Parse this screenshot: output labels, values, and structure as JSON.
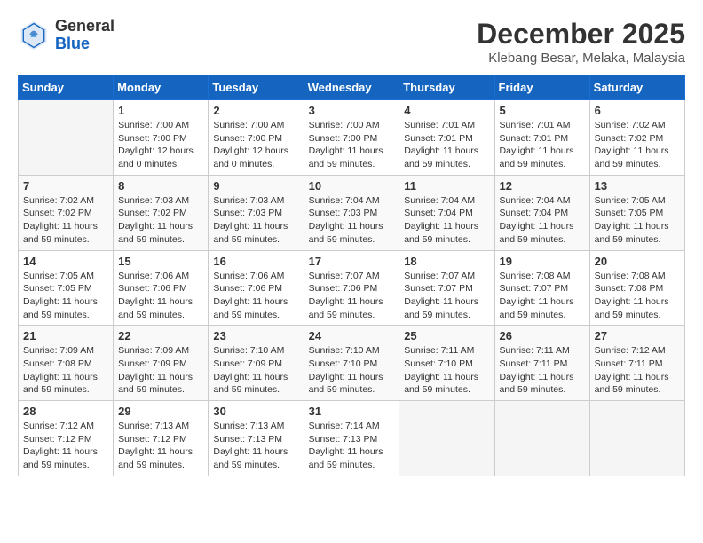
{
  "header": {
    "logo_general": "General",
    "logo_blue": "Blue",
    "month_title": "December 2025",
    "location": "Klebang Besar, Melaka, Malaysia"
  },
  "days_of_week": [
    "Sunday",
    "Monday",
    "Tuesday",
    "Wednesday",
    "Thursday",
    "Friday",
    "Saturday"
  ],
  "weeks": [
    [
      {
        "day": "",
        "info": ""
      },
      {
        "day": "1",
        "info": "Sunrise: 7:00 AM\nSunset: 7:00 PM\nDaylight: 12 hours\nand 0 minutes."
      },
      {
        "day": "2",
        "info": "Sunrise: 7:00 AM\nSunset: 7:00 PM\nDaylight: 12 hours\nand 0 minutes."
      },
      {
        "day": "3",
        "info": "Sunrise: 7:00 AM\nSunset: 7:00 PM\nDaylight: 11 hours\nand 59 minutes."
      },
      {
        "day": "4",
        "info": "Sunrise: 7:01 AM\nSunset: 7:01 PM\nDaylight: 11 hours\nand 59 minutes."
      },
      {
        "day": "5",
        "info": "Sunrise: 7:01 AM\nSunset: 7:01 PM\nDaylight: 11 hours\nand 59 minutes."
      },
      {
        "day": "6",
        "info": "Sunrise: 7:02 AM\nSunset: 7:02 PM\nDaylight: 11 hours\nand 59 minutes."
      }
    ],
    [
      {
        "day": "7",
        "info": "Sunrise: 7:02 AM\nSunset: 7:02 PM\nDaylight: 11 hours\nand 59 minutes."
      },
      {
        "day": "8",
        "info": "Sunrise: 7:03 AM\nSunset: 7:02 PM\nDaylight: 11 hours\nand 59 minutes."
      },
      {
        "day": "9",
        "info": "Sunrise: 7:03 AM\nSunset: 7:03 PM\nDaylight: 11 hours\nand 59 minutes."
      },
      {
        "day": "10",
        "info": "Sunrise: 7:04 AM\nSunset: 7:03 PM\nDaylight: 11 hours\nand 59 minutes."
      },
      {
        "day": "11",
        "info": "Sunrise: 7:04 AM\nSunset: 7:04 PM\nDaylight: 11 hours\nand 59 minutes."
      },
      {
        "day": "12",
        "info": "Sunrise: 7:04 AM\nSunset: 7:04 PM\nDaylight: 11 hours\nand 59 minutes."
      },
      {
        "day": "13",
        "info": "Sunrise: 7:05 AM\nSunset: 7:05 PM\nDaylight: 11 hours\nand 59 minutes."
      }
    ],
    [
      {
        "day": "14",
        "info": "Sunrise: 7:05 AM\nSunset: 7:05 PM\nDaylight: 11 hours\nand 59 minutes."
      },
      {
        "day": "15",
        "info": "Sunrise: 7:06 AM\nSunset: 7:06 PM\nDaylight: 11 hours\nand 59 minutes."
      },
      {
        "day": "16",
        "info": "Sunrise: 7:06 AM\nSunset: 7:06 PM\nDaylight: 11 hours\nand 59 minutes."
      },
      {
        "day": "17",
        "info": "Sunrise: 7:07 AM\nSunset: 7:06 PM\nDaylight: 11 hours\nand 59 minutes."
      },
      {
        "day": "18",
        "info": "Sunrise: 7:07 AM\nSunset: 7:07 PM\nDaylight: 11 hours\nand 59 minutes."
      },
      {
        "day": "19",
        "info": "Sunrise: 7:08 AM\nSunset: 7:07 PM\nDaylight: 11 hours\nand 59 minutes."
      },
      {
        "day": "20",
        "info": "Sunrise: 7:08 AM\nSunset: 7:08 PM\nDaylight: 11 hours\nand 59 minutes."
      }
    ],
    [
      {
        "day": "21",
        "info": "Sunrise: 7:09 AM\nSunset: 7:08 PM\nDaylight: 11 hours\nand 59 minutes."
      },
      {
        "day": "22",
        "info": "Sunrise: 7:09 AM\nSunset: 7:09 PM\nDaylight: 11 hours\nand 59 minutes."
      },
      {
        "day": "23",
        "info": "Sunrise: 7:10 AM\nSunset: 7:09 PM\nDaylight: 11 hours\nand 59 minutes."
      },
      {
        "day": "24",
        "info": "Sunrise: 7:10 AM\nSunset: 7:10 PM\nDaylight: 11 hours\nand 59 minutes."
      },
      {
        "day": "25",
        "info": "Sunrise: 7:11 AM\nSunset: 7:10 PM\nDaylight: 11 hours\nand 59 minutes."
      },
      {
        "day": "26",
        "info": "Sunrise: 7:11 AM\nSunset: 7:11 PM\nDaylight: 11 hours\nand 59 minutes."
      },
      {
        "day": "27",
        "info": "Sunrise: 7:12 AM\nSunset: 7:11 PM\nDaylight: 11 hours\nand 59 minutes."
      }
    ],
    [
      {
        "day": "28",
        "info": "Sunrise: 7:12 AM\nSunset: 7:12 PM\nDaylight: 11 hours\nand 59 minutes."
      },
      {
        "day": "29",
        "info": "Sunrise: 7:13 AM\nSunset: 7:12 PM\nDaylight: 11 hours\nand 59 minutes."
      },
      {
        "day": "30",
        "info": "Sunrise: 7:13 AM\nSunset: 7:13 PM\nDaylight: 11 hours\nand 59 minutes."
      },
      {
        "day": "31",
        "info": "Sunrise: 7:14 AM\nSunset: 7:13 PM\nDaylight: 11 hours\nand 59 minutes."
      },
      {
        "day": "",
        "info": ""
      },
      {
        "day": "",
        "info": ""
      },
      {
        "day": "",
        "info": ""
      }
    ]
  ]
}
